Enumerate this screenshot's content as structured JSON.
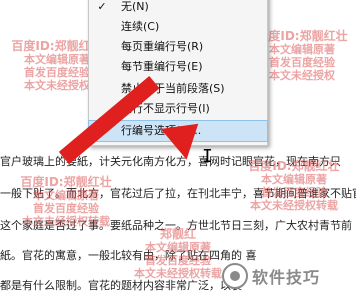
{
  "document": {
    "lines": [
      "官户玻璃上的要紙，计关元化南方化方，喜网时记眼官花，现在南方只",
      "一般下贴了。而北方，官花过后了拉，在刊北丰宁，喜节期间普谁家不贴官",
      "这个家庭是否过了事。要纸品种之一。方世北节日三刻，广大农村青节前",
      "紙。官花的寓意，一般北较有由，除了贴在四角的 喜",
      "都是有什么限制。官花的题材内容非常广泛，以装"
    ]
  },
  "watermarks": [
    {
      "line1": "百度ID:郑靓红壮",
      "line2": "本文编辑原著",
      "line3": "首发百度经验",
      "line4": "本文未经授权"
    },
    {
      "line1": "百度ID:郑靓红壮",
      "line2": "本文编辑原著",
      "line3": "首发百度经验",
      "line4": "本文未经授权"
    },
    {
      "line1": "百度ID:郑靓红壮",
      "line2": "本文编辑原著",
      "line3": "首发百度经验",
      "line4": "本文未经授权转载"
    },
    {
      "line1": "本文编辑原著",
      "line2": "首发百度经验",
      "line3": "本文未经授权转载",
      "line4": ""
    },
    {
      "line1": "百度ID:郑靓红壮",
      "line2": "本文编辑原著",
      "line3": "首发百度经验",
      "line4": "本文未经授权转载"
    },
    {
      "line1": "郑靓红",
      "line2": "本文编辑原著",
      "line3": "首发百度经验",
      "line4": "本文未经授权转载"
    }
  ],
  "menu": {
    "items": [
      {
        "check": "✓",
        "label": "无(N)"
      },
      {
        "check": "",
        "label": "连续(C)"
      },
      {
        "check": "",
        "label": "每页重编行号(R)"
      },
      {
        "check": "",
        "label": "每节重编行号(E)"
      },
      {
        "check": "",
        "label": "禁止用于当前段落(S)"
      },
      {
        "check": "",
        "label": "空行不显示行号(I)"
      },
      {
        "check": "",
        "label": "行编号选项(L)..."
      }
    ],
    "highlighted_index": 6
  },
  "brand": {
    "text": "软件技巧"
  },
  "colors": {
    "arrow": "#e0201f",
    "menu_bg": "#f5f5f5",
    "highlight": "#cde4f7",
    "watermark": "rgba(220,90,90,0.55)"
  }
}
